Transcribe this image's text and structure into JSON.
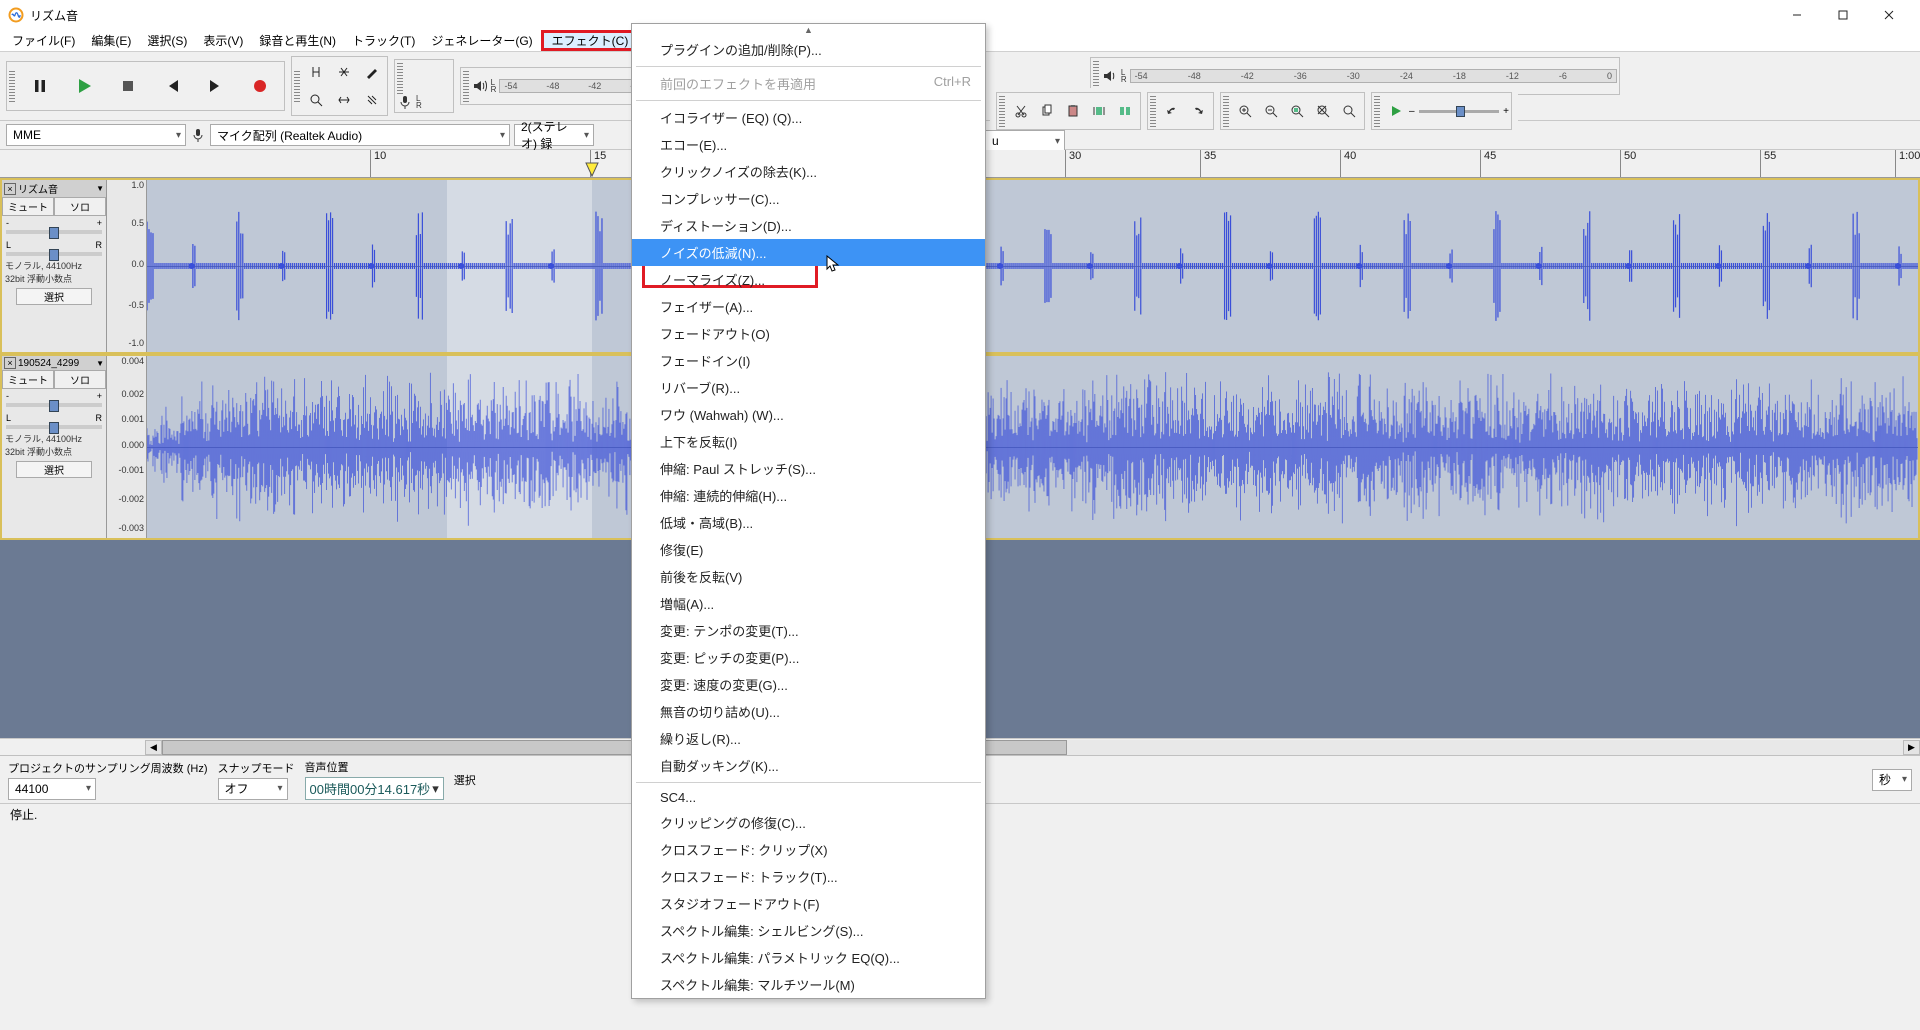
{
  "window": {
    "title": "リズム音"
  },
  "menubar": {
    "items": [
      "ファイル(F)",
      "編集(E)",
      "選択(S)",
      "表示(V)",
      "録音と再生(N)",
      "トラック(T)",
      "ジェネレーター(G)",
      "エフェクト(C)"
    ]
  },
  "devices": {
    "host": "MME",
    "input": "マイク配列 (Realtek Audio)",
    "input_ch": "2(ステレオ) 録",
    "output": "u"
  },
  "meter_ticks": [
    "-54",
    "-48",
    "-42",
    "-36",
    "-30",
    "-24",
    "-18",
    "-12",
    "-6",
    "0"
  ],
  "timeline_labels": [
    "10",
    "15",
    "30",
    "35",
    "40",
    "45",
    "50",
    "55",
    "1:00"
  ],
  "tracks": {
    "t1": {
      "name": "リズム音",
      "mute": "ミュート",
      "solo": "ソロ",
      "gain_ends": [
        "-",
        "+"
      ],
      "pan_ends": [
        "L",
        "R"
      ],
      "info1": "モノラル, 44100Hz",
      "info2": "32bit 浮動小数点",
      "select": "選択",
      "scale": [
        "1.0",
        "0.5",
        "0.0",
        "-0.5",
        "-1.0"
      ]
    },
    "t2": {
      "name": "190524_4299",
      "mute": "ミュート",
      "solo": "ソロ",
      "gain_ends": [
        "-",
        "+"
      ],
      "pan_ends": [
        "L",
        "R"
      ],
      "info1": "モノラル, 44100Hz",
      "info2": "32bit 浮動小数点",
      "select": "選択",
      "scale": [
        "0.004",
        "0.002",
        "0.001",
        "0.000",
        "-0.001",
        "-0.002",
        "-0.003"
      ]
    }
  },
  "dropdown": {
    "items": [
      {
        "label": "プラグインの追加/削除(P)...",
        "type": "item"
      },
      {
        "type": "sep"
      },
      {
        "label": "前回のエフェクトを再適用",
        "accel": "Ctrl+R",
        "disabled": true,
        "type": "item"
      },
      {
        "type": "sep"
      },
      {
        "label": "イコライザー (EQ) (Q)...",
        "type": "item"
      },
      {
        "label": "エコー(E)...",
        "type": "item"
      },
      {
        "label": "クリックノイズの除去(K)...",
        "type": "item"
      },
      {
        "label": "コンプレッサー(C)...",
        "type": "item"
      },
      {
        "label": "ディストーション(D)...",
        "type": "item"
      },
      {
        "label": "ノイズの低減(N)...",
        "hovered": true,
        "type": "item"
      },
      {
        "label": "ノーマライズ(Z)...",
        "type": "item"
      },
      {
        "label": "フェイザー(A)...",
        "type": "item"
      },
      {
        "label": "フェードアウト(O)",
        "type": "item"
      },
      {
        "label": "フェードイン(I)",
        "type": "item"
      },
      {
        "label": "リバーブ(R)...",
        "type": "item"
      },
      {
        "label": "ワウ (Wahwah) (W)...",
        "type": "item"
      },
      {
        "label": "上下を反転(I)",
        "type": "item"
      },
      {
        "label": "伸縮: Paul ストレッチ(S)...",
        "type": "item"
      },
      {
        "label": "伸縮: 連続的伸縮(H)...",
        "type": "item"
      },
      {
        "label": "低域・高域(B)...",
        "type": "item"
      },
      {
        "label": "修復(E)",
        "type": "item"
      },
      {
        "label": "前後を反転(V)",
        "type": "item"
      },
      {
        "label": "増幅(A)...",
        "type": "item"
      },
      {
        "label": "変更: テンポの変更(T)...",
        "type": "item"
      },
      {
        "label": "変更: ピッチの変更(P)...",
        "type": "item"
      },
      {
        "label": "変更: 速度の変更(G)...",
        "type": "item"
      },
      {
        "label": "無音の切り詰め(U)...",
        "type": "item"
      },
      {
        "label": "繰り返し(R)...",
        "type": "item"
      },
      {
        "label": "自動ダッキング(K)...",
        "type": "item"
      },
      {
        "type": "sep"
      },
      {
        "label": "SC4...",
        "type": "item"
      },
      {
        "label": "クリッピングの修復(C)...",
        "type": "item"
      },
      {
        "label": "クロスフェード: クリップ(X)",
        "type": "item"
      },
      {
        "label": "クロスフェード: トラック(T)...",
        "type": "item"
      },
      {
        "label": "スタジオフェードアウト(F)",
        "type": "item"
      },
      {
        "label": "スペクトル編集: シェルビング(S)...",
        "type": "item"
      },
      {
        "label": "スペクトル編集: パラメトリック EQ(Q)...",
        "type": "item"
      },
      {
        "label": "スペクトル編集: マルチツール(M)",
        "type": "item"
      }
    ]
  },
  "selbar": {
    "rate_label": "プロジェクトのサンプリング周波数 (Hz)",
    "rate": "44100",
    "snap_label": "スナップモード",
    "snap": "オフ",
    "pos_label": "音声位置",
    "pos_value": "00時間00分14.617秒",
    "sel_label": "選択",
    "sel_unit": "秒"
  },
  "status": {
    "text": "停止."
  }
}
